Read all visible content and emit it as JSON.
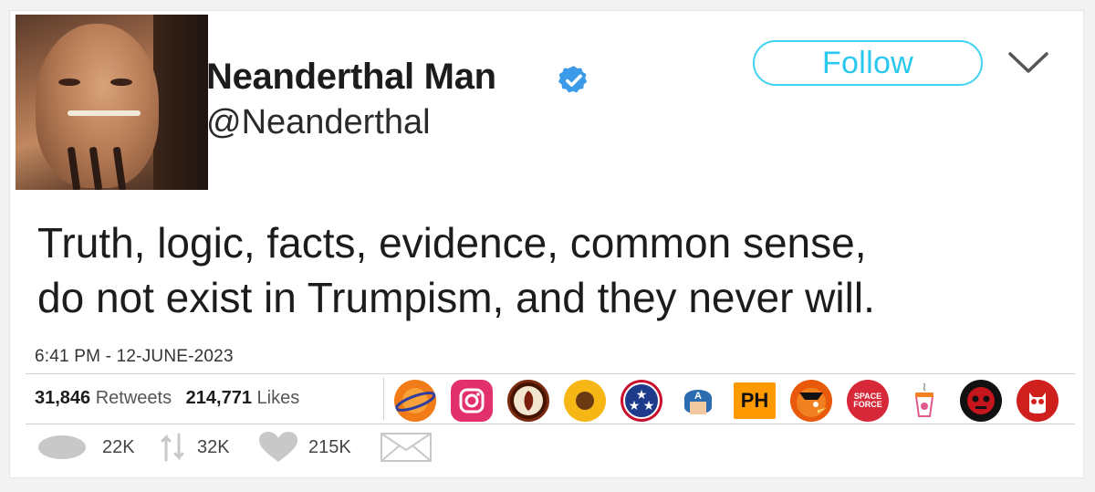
{
  "tweet": {
    "display_name": "Neanderthal Man",
    "handle": "@Neanderthal",
    "follow_label": "Follow",
    "text_lines": [
      "Truth, logic, facts, evidence, common sense,",
      "do not exist in Trumpism, and they never will."
    ],
    "timestamp": "6:41 PM - 12-JUNE-2023",
    "retweets_count": "31,846",
    "retweets_label": "Retweets",
    "likes_count": "214,771",
    "likes_label": "Likes",
    "actions": {
      "replies": "22K",
      "retweets": "32K",
      "likes": "215K"
    }
  },
  "liker_avatars": [
    {
      "name": "planet-logo-icon",
      "color": "#f07b17"
    },
    {
      "name": "instagram-logo-icon",
      "color": "#e1306c"
    },
    {
      "name": "chipotle-logo-icon",
      "color": "#451400"
    },
    {
      "name": "sunflower-icon",
      "color": "#f6b616"
    },
    {
      "name": "tennessee-stars-icon",
      "color": "#1e3a8a"
    },
    {
      "name": "captain-america-icon",
      "color": "#2b6cb0"
    },
    {
      "name": "ph-logo-icon",
      "color": "#ff9900"
    },
    {
      "name": "orioles-bird-icon",
      "color": "#e8590c"
    },
    {
      "name": "space-force-icon",
      "color": "#d62839"
    },
    {
      "name": "dunkin-cup-icon",
      "color": "#e05a8c"
    },
    {
      "name": "red-skull-icon",
      "color": "#c4161c"
    },
    {
      "name": "owl-logo-icon",
      "color": "#d0201e"
    }
  ],
  "colors": {
    "accent": "#29c8ee",
    "verified": "#3b9be8",
    "action_icon": "#c8c8c8"
  }
}
